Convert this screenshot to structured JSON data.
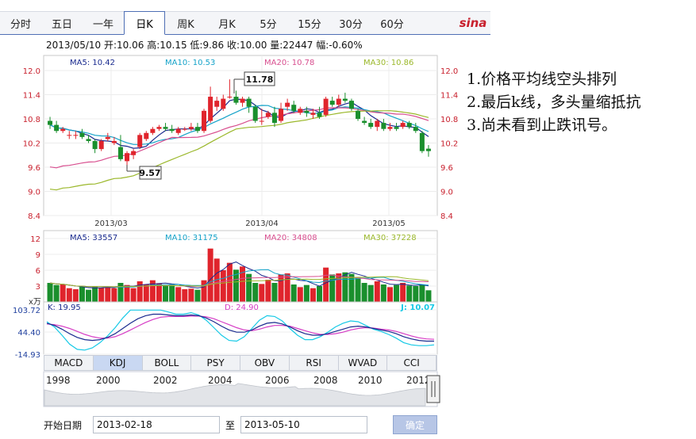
{
  "tabs": [
    "分时",
    "五日",
    "一年",
    "日K",
    "周K",
    "月K",
    "5分",
    "15分",
    "30分",
    "60分"
  ],
  "active_tab": "日K",
  "brand": "sina",
  "header_info": "2013/05/10 开:10.06  高:10.15  低:9.86  收:10.00  量:22447  幅:-0.60%",
  "price_panel": {
    "ma_labels": [
      "MA5: 10.42",
      "MA10: 10.53",
      "MA20: 10.78",
      "MA30: 10.86"
    ],
    "ma_colors": [
      "#1a2b8f",
      "#15a3c9",
      "#d84f8f",
      "#9bb82b"
    ],
    "y_ticks": [
      "12.0",
      "11.4",
      "10.8",
      "10.2",
      "9.6",
      "9.0",
      "8.4"
    ],
    "y_values": [
      12.0,
      11.4,
      10.8,
      10.2,
      9.6,
      9.0,
      8.4
    ],
    "x_labels": [
      "2013/03",
      "2013/04",
      "2013/05"
    ],
    "high_label": "11.78",
    "low_label": "9.57"
  },
  "volume_panel": {
    "ma_labels": [
      "MA5: 33557",
      "MA10: 31175",
      "MA20: 34808",
      "MA30: 37228"
    ],
    "y_ticks": [
      "12",
      "9",
      "6",
      "3"
    ],
    "unit": "x万"
  },
  "kdj_panel": {
    "labels": [
      "K: 19.95",
      "D: 24.90",
      "J: 10.07"
    ],
    "label_colors": [
      "#1a2b8f",
      "#d63cc5",
      "#15c9e6"
    ],
    "y_ticks": [
      "103.72",
      "44.40",
      "-14.93"
    ]
  },
  "indicator_tabs": [
    "MACD",
    "KDJ",
    "BOLL",
    "PSY",
    "OBV",
    "RSI",
    "WVAD",
    "CCI"
  ],
  "active_indicator": "KDJ",
  "overview_years": [
    "1998",
    "2000",
    "2002",
    "2004",
    "2006",
    "2008",
    "2010",
    "2012"
  ],
  "date_range": {
    "start_label": "开始日期",
    "start_value": "2013-02-18",
    "to_label": "至",
    "end_value": "2013-05-10",
    "confirm_label": "确定"
  },
  "notes": [
    "1.价格平均线空头排列",
    "2.最后k线，多头量缩抵抗",
    "3.尚未看到止跌讯号。"
  ],
  "colors": {
    "up": "#e0242c",
    "down": "#1a8f2d",
    "tab_border": "#4f6fb5"
  }
}
